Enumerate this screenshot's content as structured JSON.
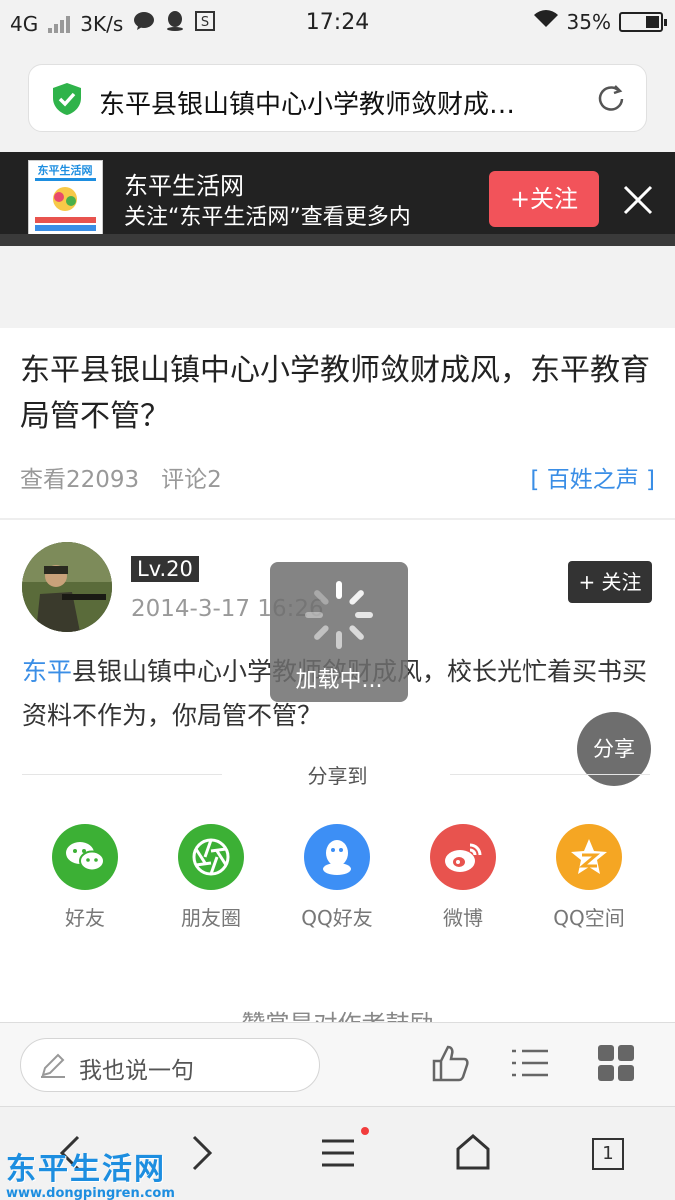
{
  "status_bar": {
    "network": "4G",
    "speed": "3K/s",
    "time": "17:24",
    "battery": "35%",
    "battery_level": 0.35
  },
  "url_bar": {
    "url_text": "东平县银山镇中心小学教师敛财成…"
  },
  "banner": {
    "site_name": "东平生活网",
    "subtitle": "关注“东平生活网”查看更多内",
    "follow_label": "+关注",
    "logo_text": "东平生活网"
  },
  "article": {
    "title": "东平县银山镇中心小学教师敛财成风，东平教育局管不管？",
    "views": "查看22093",
    "comments": "评论2",
    "category": "[ 百姓之声 ]",
    "author_level": "Lv.20",
    "post_date": "2014-3-17 16:26",
    "follow_label": "+ 关注",
    "body_link": "东平",
    "body_rest": "县银山镇中心小学教师敛财成风，校长光忙着买书买资料不作为，你局管不管？",
    "share_fab": "分享",
    "loading_label": "加载中...",
    "share_to": "分享到",
    "share_targets": [
      {
        "label": "好友",
        "icon": "wechat-icon",
        "color": "#3cb035"
      },
      {
        "label": "朋友圈",
        "icon": "moments-icon",
        "color": "#3cb035"
      },
      {
        "label": "QQ好友",
        "icon": "qq-icon",
        "color": "#3d8ff5"
      },
      {
        "label": "微博",
        "icon": "weibo-icon",
        "color": "#e8534e"
      },
      {
        "label": "QQ空间",
        "icon": "qzone-icon",
        "color": "#f5a623"
      }
    ],
    "reward_text": "赞赏是对作者鼓励"
  },
  "comment_bar": {
    "placeholder": "我也说一句"
  },
  "nav_bar": {
    "tab_count": "1"
  },
  "watermark": {
    "line1": "东平生活网",
    "line2": "www.dongpingren.com"
  }
}
